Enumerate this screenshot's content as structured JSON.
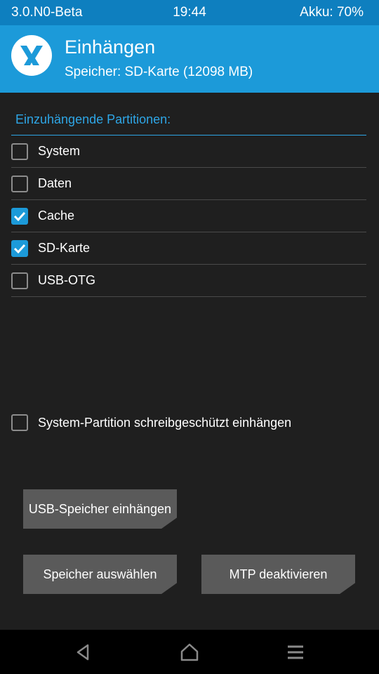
{
  "status_bar": {
    "version": "3.0.N0-Beta",
    "time": "19:44",
    "battery": "Akku: 70%"
  },
  "header": {
    "title": "Einhängen",
    "subtitle": "Speicher: SD-Karte (12098 MB)"
  },
  "partitions": {
    "heading": "Einzuhängende Partitionen:",
    "items": [
      {
        "label": "System",
        "checked": false
      },
      {
        "label": "Daten",
        "checked": false
      },
      {
        "label": "Cache",
        "checked": true
      },
      {
        "label": "SD-Karte",
        "checked": true
      },
      {
        "label": "USB-OTG",
        "checked": false
      }
    ]
  },
  "readonly_option": {
    "label": "System-Partition schreibgeschützt einhängen",
    "checked": false
  },
  "buttons": {
    "usb_storage": "USB-Speicher einhängen",
    "select_storage": "Speicher auswählen",
    "mtp": "MTP deaktivieren"
  },
  "navigation": {
    "icons": [
      "back-icon",
      "home-icon",
      "menu-icon"
    ]
  },
  "colors": {
    "accent": "#1c9ad9",
    "status_bar": "#0e7fbf",
    "background": "#1f1f1f",
    "button": "#5a5a5a"
  }
}
